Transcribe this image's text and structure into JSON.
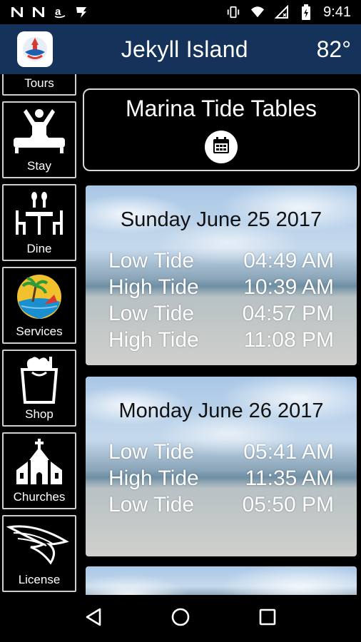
{
  "status_bar": {
    "time": "9:41",
    "left_icons": [
      "notification-n-icon",
      "notification-n-icon",
      "amazon-icon",
      "checkmark-app-icon"
    ],
    "right_icons": [
      "vibrate-icon",
      "wifi-icon",
      "no-sim-icon",
      "battery-charging-icon"
    ]
  },
  "app_bar": {
    "title": "Jekyll Island",
    "temperature": "82°",
    "logo_icon": "jekyll-island-logo"
  },
  "sidebar": {
    "items": [
      {
        "label": "Tours",
        "icon": "tours-icon"
      },
      {
        "label": "Stay",
        "icon": "bed-person-icon"
      },
      {
        "label": "Dine",
        "icon": "dining-table-icon"
      },
      {
        "label": "Services",
        "icon": "palm-beach-icon"
      },
      {
        "label": "Shop",
        "icon": "shopping-bag-icon"
      },
      {
        "label": "Churches",
        "icon": "church-icon"
      },
      {
        "label": "License",
        "icon": "wings-license-icon"
      }
    ]
  },
  "header": {
    "title": "Marina Tide Tables",
    "calendar_icon": "calendar-icon"
  },
  "days": [
    {
      "date": "Sunday June 25 2017",
      "tides": [
        {
          "type": "Low Tide",
          "time": "04:49 AM"
        },
        {
          "type": "High Tide",
          "time": "10:39 AM"
        },
        {
          "type": "Low Tide",
          "time": "04:57 PM"
        },
        {
          "type": "High Tide",
          "time": "11:08 PM"
        }
      ]
    },
    {
      "date": "Monday June 26 2017",
      "tides": [
        {
          "type": "Low Tide",
          "time": "05:41 AM"
        },
        {
          "type": "High Tide",
          "time": "11:35 AM"
        },
        {
          "type": "Low Tide",
          "time": "05:50 PM"
        }
      ]
    }
  ],
  "nav_bar": {
    "buttons": [
      "back-icon",
      "home-icon",
      "recents-icon"
    ]
  },
  "colors": {
    "app_bar": "#14325a",
    "background": "#000000",
    "border": "#cfcfcf"
  }
}
